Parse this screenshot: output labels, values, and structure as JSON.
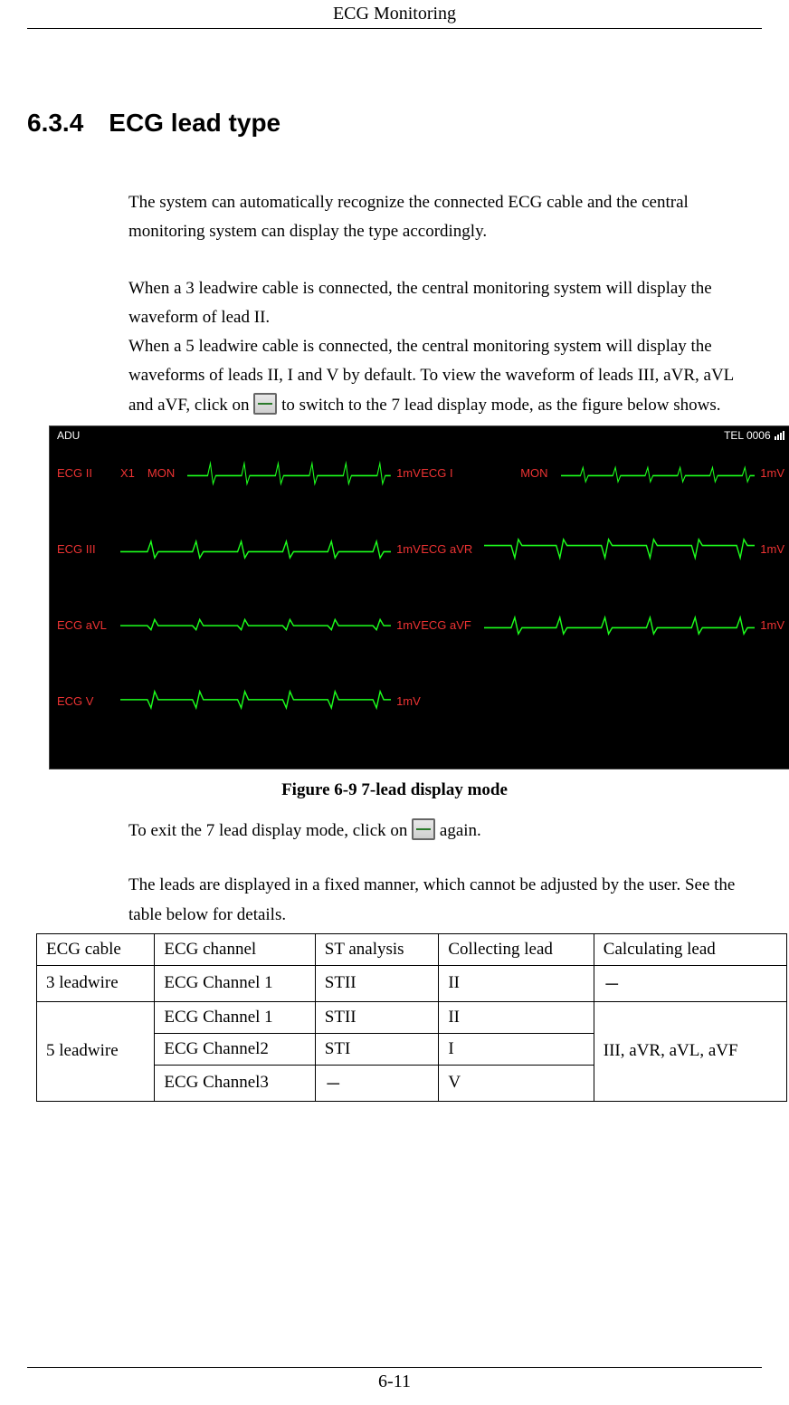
{
  "header": "ECG Monitoring",
  "section": {
    "number": "6.3.4",
    "title": "ECG lead type"
  },
  "para1": "The system can automatically recognize the connected ECG cable and the central monitoring system can display the type accordingly.",
  "para2a": "When a 3 leadwire cable is connected, the central monitoring system will display the waveform of lead II.",
  "para2b_before": "When a 5 leadwire cable is connected, the central monitoring system will display the waveforms of leads II, I and V by default. To view the waveform of  leads III, aVR, aVL and aVF, click on ",
  "para2b_after": " to switch to the 7 lead display mode, as the figure below shows.",
  "monitor": {
    "top_left": "ADU",
    "top_right": "TEL 0006",
    "leads": {
      "l1": {
        "label": "ECG II",
        "x": "X1",
        "mon": "MON",
        "mv": "1mV"
      },
      "r1": {
        "label": "ECG I",
        "mon": "MON",
        "mv": "1mV"
      },
      "l2": {
        "label": "ECG III",
        "mv": "1mV"
      },
      "r2": {
        "label": "ECG aVR",
        "mv": "1mV"
      },
      "l3": {
        "label": "ECG aVL",
        "mv": "1mV"
      },
      "r3": {
        "label": "ECG aVF",
        "mv": "1mV"
      },
      "l4": {
        "label": "ECG V",
        "mv": "1mV"
      }
    }
  },
  "figure_caption": "Figure 6-9 7-lead display mode",
  "para3_before": "To exit the 7 lead display mode, click on ",
  "para3_after": " again.",
  "para4": "The leads are displayed in a fixed manner, which cannot be adjusted by the user. See the table below for details.",
  "table": {
    "headers": {
      "c1": "ECG cable",
      "c2": "ECG channel",
      "c3": "ST analysis",
      "c4": "Collecting lead",
      "c5": "Calculating lead"
    },
    "r1": {
      "c1": "3 leadwire",
      "c2": "ECG Channel 1",
      "c3": "STII",
      "c4": "II",
      "c5": "－"
    },
    "r2": {
      "c1": "5 leadwire",
      "c2": "ECG Channel 1",
      "c3": "STII",
      "c4": "II",
      "c5": "III, aVR, aVL, aVF"
    },
    "r3": {
      "c2": "ECG Channel2",
      "c3": "STI",
      "c4": "I"
    },
    "r4": {
      "c2": "ECG Channel3",
      "c3": "－",
      "c4": "V"
    }
  },
  "footer": "6-11"
}
